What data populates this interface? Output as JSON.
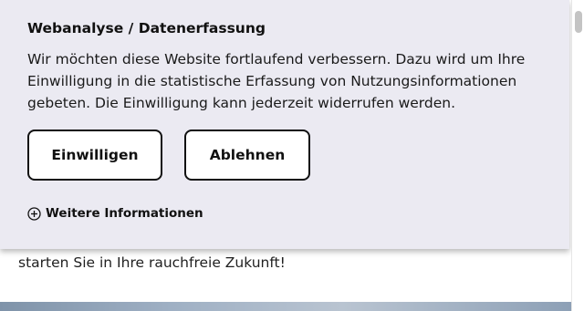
{
  "background": {
    "text": "starten Sie in Ihre rauchfreie Zukunft!"
  },
  "consent": {
    "title": "Webanalyse / Datenerfassung",
    "text": "Wir möchten diese Website fortlaufend verbessern. Dazu wird um Ihre Einwilligung in die statistische Erfassung von Nutzungsinformationen gebeten. Die Einwilligung kann jederzeit widerrufen werden.",
    "accept_label": "Einwilligen",
    "decline_label": "Ablehnen",
    "more_info_label": "Weitere Informationen",
    "more_info_icon": "plus-circle-icon"
  },
  "colors": {
    "banner_background": "#ebeaf2",
    "button_border": "#111111",
    "button_background": "#ffffff"
  }
}
